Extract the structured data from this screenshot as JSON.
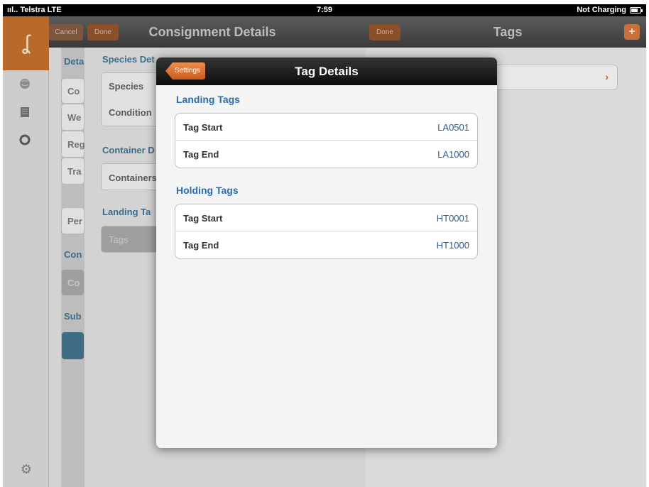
{
  "status_bar": {
    "carrier": "ııl.. Telstra  LTE",
    "time": "7:59",
    "charging": "Not Charging"
  },
  "master": {
    "title": "Consignment Details",
    "cancel_label": "Cancel",
    "done_label": "Done",
    "col1_labels": [
      "Deta",
      "Co",
      "We",
      "Reg",
      "Tra",
      "Per",
      "Con",
      "Co",
      "Sub"
    ],
    "species_details_header": "Species Det",
    "species_label": "Species",
    "condition_label": "Condition",
    "container_header": "Container D",
    "containers_label": "Containers",
    "landing_tags_header": "Landing Ta",
    "tags_label": "Tags"
  },
  "detail": {
    "title": "Tags",
    "done_label": "Done",
    "add_icon": "plus-icon"
  },
  "popover": {
    "back_label": "Settings",
    "title": "Tag Details",
    "sections": [
      {
        "title": "Landing Tags",
        "rows": [
          {
            "label": "Tag Start",
            "value": "LA0501"
          },
          {
            "label": "Tag End",
            "value": "LA1000"
          }
        ]
      },
      {
        "title": "Holding Tags",
        "rows": [
          {
            "label": "Tag Start",
            "value": "HT0001"
          },
          {
            "label": "Tag End",
            "value": "HT1000"
          }
        ]
      }
    ]
  },
  "sidebar": {
    "icons": [
      "hook-logo-icon",
      "globe-icon",
      "document-icon",
      "lifebuoy-icon",
      "gear-icon"
    ]
  },
  "colors": {
    "accent_orange": "#c85d1c",
    "link_blue": "#2a6eb0",
    "nav_dark": "#0d0d0d"
  }
}
